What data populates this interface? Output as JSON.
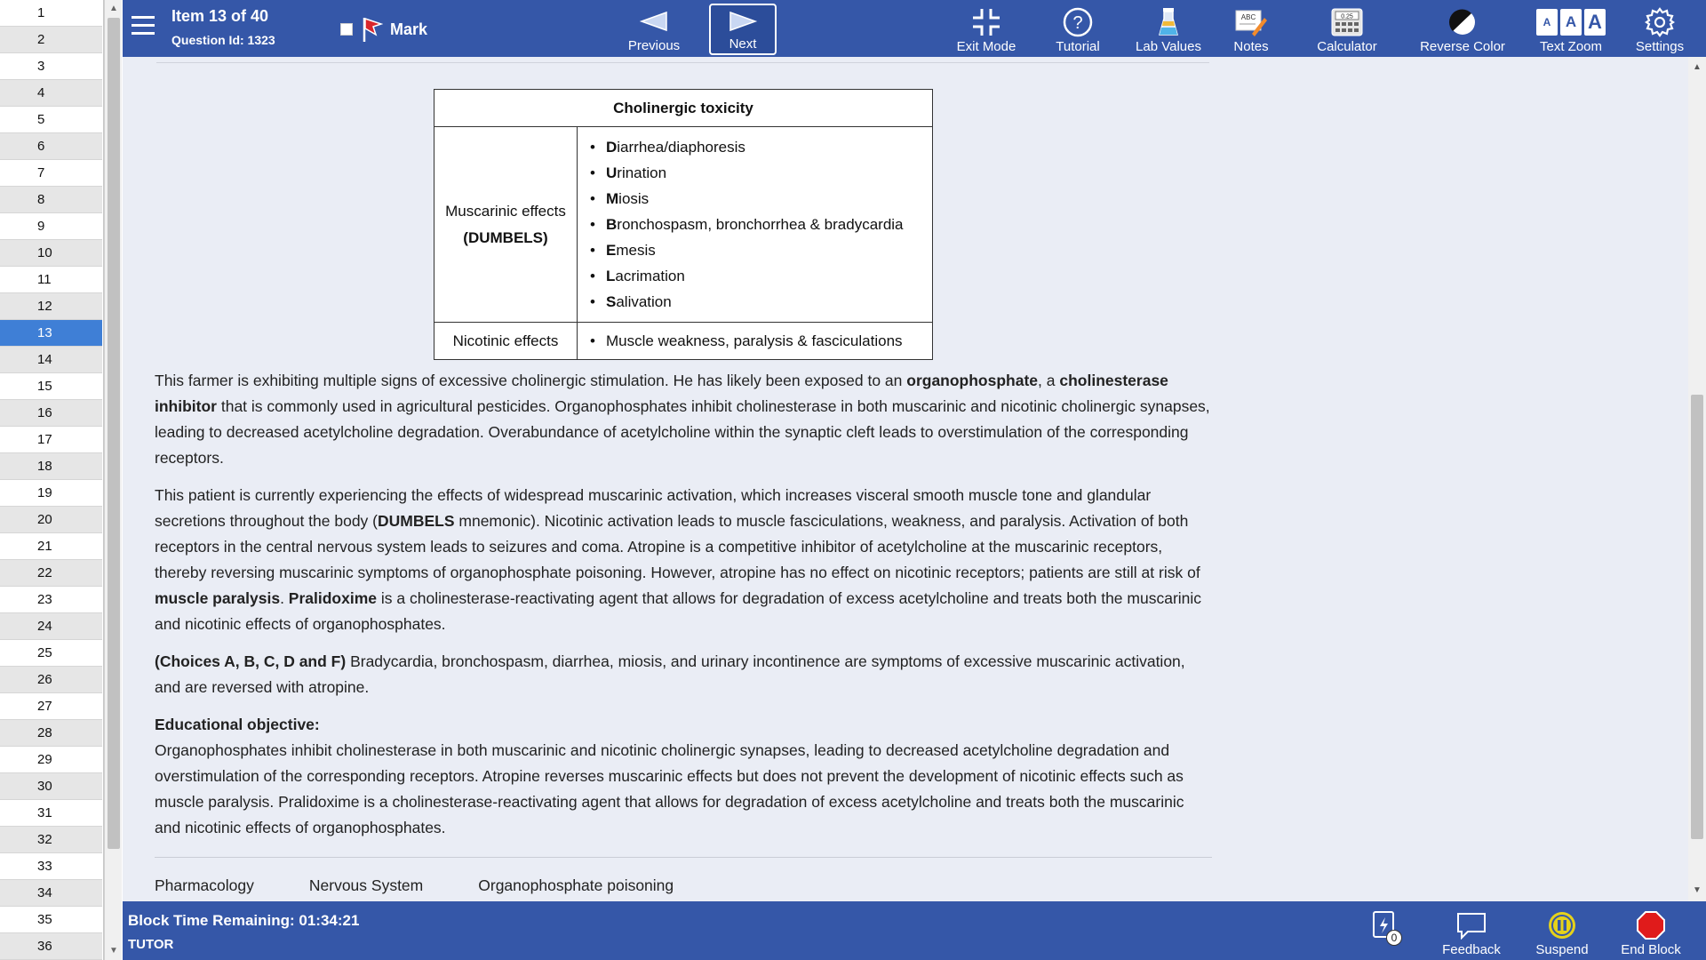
{
  "question_list": {
    "items": [
      "1",
      "2",
      "3",
      "4",
      "5",
      "6",
      "7",
      "8",
      "9",
      "10",
      "11",
      "12",
      "13",
      "14",
      "15",
      "16",
      "17",
      "18",
      "19",
      "20",
      "21",
      "22",
      "23",
      "24",
      "25",
      "26",
      "27",
      "28",
      "29",
      "30",
      "31",
      "32",
      "33",
      "34",
      "35",
      "36"
    ],
    "active": "13"
  },
  "header": {
    "item_label": "Item 13 of 40",
    "question_id": "Question Id: 1323",
    "mark_label": "Mark",
    "previous_label": "Previous",
    "next_label": "Next",
    "tools": {
      "exit_mode": "Exit Mode",
      "tutorial": "Tutorial",
      "lab_values": "Lab Values",
      "notes": "Notes",
      "calculator": "Calculator",
      "reverse_color": "Reverse Color",
      "text_zoom": "Text Zoom",
      "settings": "Settings"
    },
    "calculator_display": "0.25",
    "notes_icon_text": "ABC",
    "text_zoom_letters": [
      "A",
      "A",
      "A"
    ]
  },
  "table": {
    "title": "Cholinergic toxicity",
    "muscarinic_label": "Muscarinic effects",
    "muscarinic_mnemonic": "(DUMBELS)",
    "muscarinic_items": [
      {
        "first": "D",
        "rest": "iarrhea/diaphoresis"
      },
      {
        "first": "U",
        "rest": "rination"
      },
      {
        "first": "M",
        "rest": "iosis"
      },
      {
        "first": "B",
        "rest": "ronchospasm, bronchorrhea & bradycardia"
      },
      {
        "first": "E",
        "rest": "mesis"
      },
      {
        "first": "L",
        "rest": "acrimation"
      },
      {
        "first": "S",
        "rest": "alivation"
      }
    ],
    "nicotinic_label": "Nicotinic effects",
    "nicotinic_item": "Muscle weakness, paralysis & fasciculations"
  },
  "explanation": {
    "p1": [
      {
        "t": "This farmer is exhibiting multiple signs of excessive cholinergic stimulation.  He has likely been exposed to an ",
        "b": false
      },
      {
        "t": "organophosphate",
        "b": true
      },
      {
        "t": ", a ",
        "b": false
      },
      {
        "t": "cholinesterase inhibitor",
        "b": true
      },
      {
        "t": " that is commonly used in agricultural pesticides.  Organophosphates inhibit cholinesterase in both muscarinic and nicotinic cholinergic synapses, leading to decreased acetylcholine degradation.  Overabundance of acetylcholine within the synaptic cleft leads to overstimulation of the corresponding receptors.",
        "b": false
      }
    ],
    "p2": [
      {
        "t": "This patient is currently experiencing the effects of widespread muscarinic activation, which increases visceral smooth muscle tone and glandular secretions throughout the body (",
        "b": false
      },
      {
        "t": "DUMBELS",
        "b": true
      },
      {
        "t": " mnemonic).  Nicotinic activation leads to muscle fasciculations, weakness, and paralysis.  Activation of both receptors in the central nervous system leads to seizures and coma.  Atropine is a competitive inhibitor of acetylcholine at the muscarinic receptors, thereby reversing muscarinic symptoms of organophosphate poisoning.  However, atropine has no effect on nicotinic receptors; patients are still at risk of ",
        "b": false
      },
      {
        "t": "muscle paralysis",
        "b": true
      },
      {
        "t": ".  ",
        "b": false
      },
      {
        "t": "Pralidoxime",
        "b": true
      },
      {
        "t": " is a cholinesterase-reactivating agent that allows for degradation of excess acetylcholine and treats both the muscarinic and nicotinic effects of organophosphates.",
        "b": false
      }
    ],
    "p3": [
      {
        "t": "(Choices A, B, C, D and F)",
        "b": true
      },
      {
        "t": "  Bradycardia, bronchospasm, diarrhea, miosis, and urinary incontinence are symptoms of excessive muscarinic activation, and are reversed with atropine.",
        "b": false
      }
    ],
    "objective_heading": "Educational objective:",
    "objective_text": "Organophosphates inhibit cholinesterase in both muscarinic and nicotinic cholinergic synapses, leading to decreased acetylcholine degradation and overstimulation of the corresponding receptors.  Atropine reverses muscarinic effects but does not prevent the development of nicotinic effects such as muscle paralysis.  Pralidoxime is a cholinesterase-reactivating agent that allows for degradation of excess acetylcholine and treats both the muscarinic and nicotinic effects of organophosphates."
  },
  "tags": [
    "Pharmacology",
    "Nervous System",
    "Organophosphate poisoning"
  ],
  "footer": {
    "timer": "Block Time Remaining: 01:34:21",
    "mode": "TUTOR",
    "flashcard_count": "0",
    "feedback": "Feedback",
    "suspend": "Suspend",
    "end_block": "End Block"
  },
  "colors": {
    "bar": "#3557a8",
    "active_item": "#3f7fd6",
    "content_bg": "#eaedf5",
    "mark_flag": "#d9262c",
    "suspend": "#e6d21a",
    "end_block": "#e01b1b"
  }
}
